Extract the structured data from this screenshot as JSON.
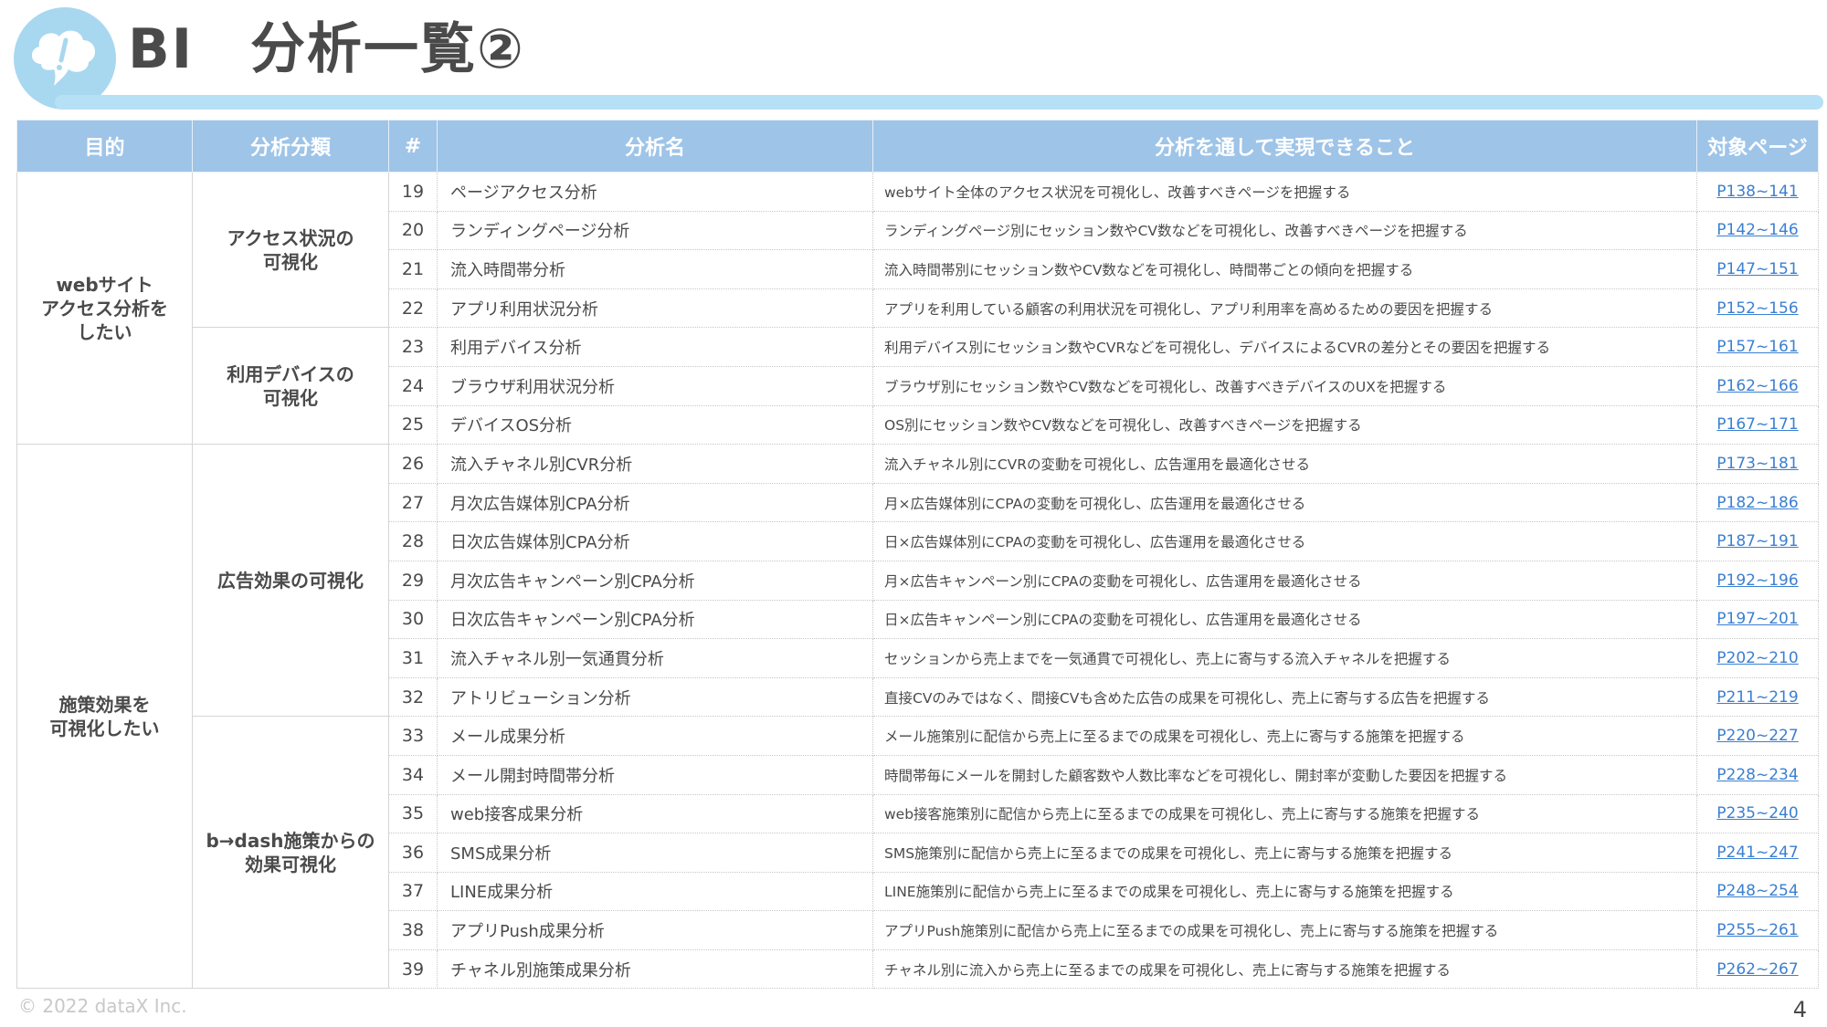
{
  "header": {
    "title": "BI　分析一覧②"
  },
  "table": {
    "columns": [
      "目的",
      "分析分類",
      "#",
      "分析名",
      "分析を通して実現できること",
      "対象ページ"
    ],
    "purposes": [
      "webサイト\nアクセス分析を\nしたい",
      "施策効果を\n可視化したい"
    ],
    "categories": [
      "アクセス状況の\n可視化",
      "利用デバイスの\n可視化",
      "広告効果の可視化",
      "b→dash施策からの\n効果可視化"
    ],
    "rows": [
      {
        "num": "19",
        "name": "ページアクセス分析",
        "desc": "webサイト全体のアクセス状況を可視化し、改善すべきページを把握する",
        "page": "P138~141"
      },
      {
        "num": "20",
        "name": "ランディングページ分析",
        "desc": "ランディングページ別にセッション数やCV数などを可視化し、改善すべきページを把握する",
        "page": "P142~146"
      },
      {
        "num": "21",
        "name": "流入時間帯分析",
        "desc": "流入時間帯別にセッション数やCV数などを可視化し、時間帯ごとの傾向を把握する",
        "page": "P147~151"
      },
      {
        "num": "22",
        "name": "アプリ利用状況分析",
        "desc": "アプリを利用している顧客の利用状況を可視化し、アプリ利用率を高めるための要因を把握する",
        "page": "P152~156"
      },
      {
        "num": "23",
        "name": "利用デバイス分析",
        "desc": "利用デバイス別にセッション数やCVRなどを可視化し、デバイスによるCVRの差分とその要因を把握する",
        "page": "P157~161"
      },
      {
        "num": "24",
        "name": "ブラウザ利用状況分析",
        "desc": "ブラウザ別にセッション数やCV数などを可視化し、改善すべきデバイスのUXを把握する",
        "page": "P162~166"
      },
      {
        "num": "25",
        "name": "デバイスOS分析",
        "desc": "OS別にセッション数やCV数などを可視化し、改善すべきページを把握する",
        "page": "P167~171"
      },
      {
        "num": "26",
        "name": "流入チャネル別CVR分析",
        "desc": "流入チャネル別にCVRの変動を可視化し、広告運用を最適化させる",
        "page": "P173~181"
      },
      {
        "num": "27",
        "name": "月次広告媒体別CPA分析",
        "desc": "月×広告媒体別にCPAの変動を可視化し、広告運用を最適化させる",
        "page": "P182~186"
      },
      {
        "num": "28",
        "name": "日次広告媒体別CPA分析",
        "desc": "日×広告媒体別にCPAの変動を可視化し、広告運用を最適化させる",
        "page": "P187~191"
      },
      {
        "num": "29",
        "name": "月次広告キャンペーン別CPA分析",
        "desc": "月×広告キャンペーン別にCPAの変動を可視化し、広告運用を最適化させる",
        "page": "P192~196"
      },
      {
        "num": "30",
        "name": "日次広告キャンペーン別CPA分析",
        "desc": "日×広告キャンペーン別にCPAの変動を可視化し、広告運用を最適化させる",
        "page": "P197~201"
      },
      {
        "num": "31",
        "name": "流入チャネル別一気通貫分析",
        "desc": "セッションから売上までを一気通貫で可視化し、売上に寄与する流入チャネルを把握する",
        "page": "P202~210"
      },
      {
        "num": "32",
        "name": "アトリビューション分析",
        "desc": "直接CVのみではなく、間接CVも含めた広告の成果を可視化し、売上に寄与する広告を把握する",
        "page": "P211~219"
      },
      {
        "num": "33",
        "name": "メール成果分析",
        "desc": "メール施策別に配信から売上に至るまでの成果を可視化し、売上に寄与する施策を把握する",
        "page": "P220~227"
      },
      {
        "num": "34",
        "name": "メール開封時間帯分析",
        "desc": "時間帯毎にメールを開封した顧客数や人数比率などを可視化し、開封率が変動した要因を把握する",
        "page": "P228~234"
      },
      {
        "num": "35",
        "name": "web接客成果分析",
        "desc": "web接客施策別に配信から売上に至るまでの成果を可視化し、売上に寄与する施策を把握する",
        "page": "P235~240"
      },
      {
        "num": "36",
        "name": "SMS成果分析",
        "desc": "SMS施策別に配信から売上に至るまでの成果を可視化し、売上に寄与する施策を把握する",
        "page": "P241~247"
      },
      {
        "num": "37",
        "name": "LINE成果分析",
        "desc": "LINE施策別に配信から売上に至るまでの成果を可視化し、売上に寄与する施策を把握する",
        "page": "P248~254"
      },
      {
        "num": "38",
        "name": "アプリPush成果分析",
        "desc": "アプリPush施策別に配信から売上に至るまでの成果を可視化し、売上に寄与する施策を把握する",
        "page": "P255~261"
      },
      {
        "num": "39",
        "name": "チャネル別施策成果分析",
        "desc": "チャネル別に流入から売上に至るまでの成果を可視化し、売上に寄与する施策を把握する",
        "page": "P262~267"
      }
    ]
  },
  "footer": {
    "copyright": "© 2022 dataX Inc.",
    "page_number": "4"
  },
  "colors": {
    "header_bg": "#9ec4e8",
    "accent_bar": "#b6e0f5",
    "logo_bg": "#a8d8ef",
    "link": "#3b7fd0"
  },
  "icons": {
    "logo": "thought-bubble-exclamation-icon"
  }
}
